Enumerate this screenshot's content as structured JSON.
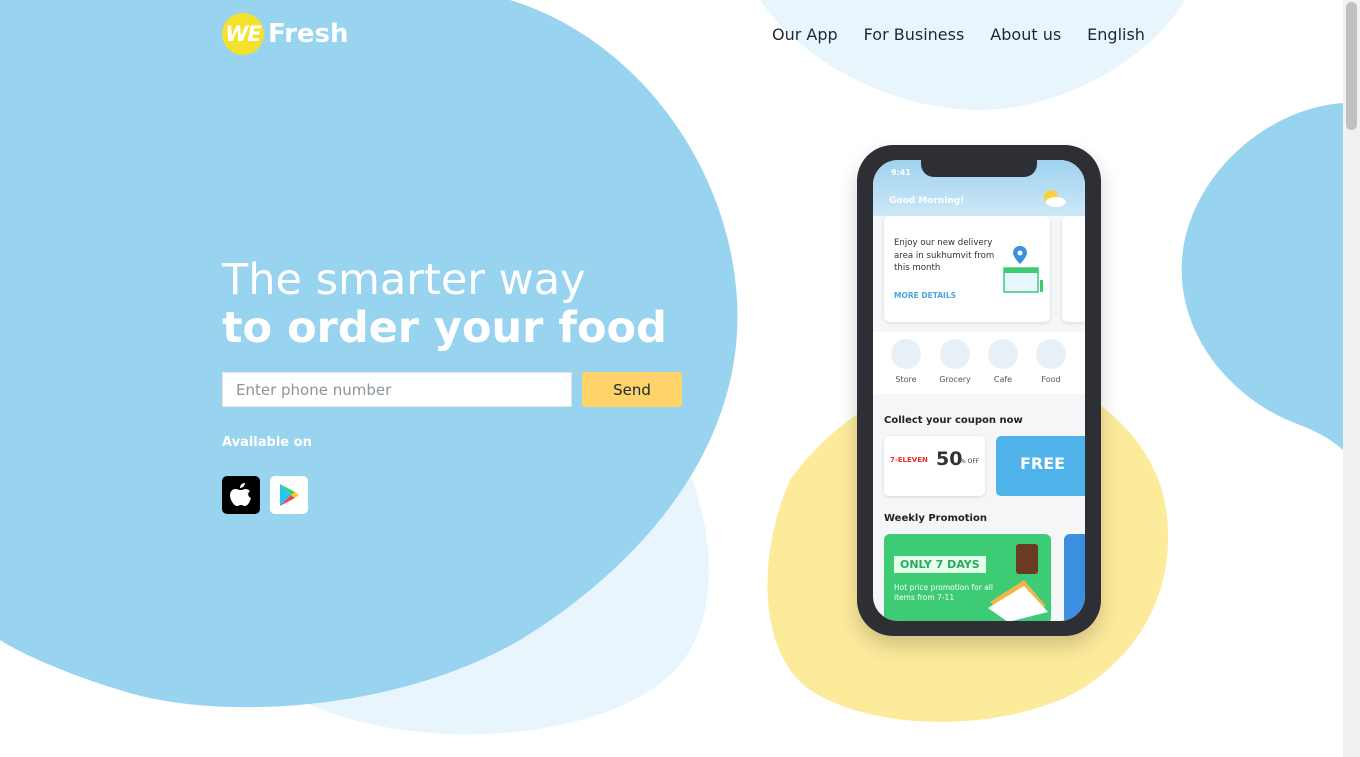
{
  "header": {
    "logo_mark": "WE",
    "logo_word": "Fresh",
    "nav": [
      "Our App",
      "For Business",
      "About us",
      "English"
    ]
  },
  "hero": {
    "line1": "The smarter way",
    "line2": "to order your food",
    "phone_placeholder": "Enter phone number",
    "send_label": "Send",
    "available_on": "Available on",
    "stores": [
      "apple-icon",
      "google-play-icon"
    ]
  },
  "app_screen": {
    "time": "9:41",
    "greeting": "Good Morning!",
    "card_text": "Enjoy our new delivery area in sukhumvit from this month",
    "card_link": "MORE DETAILS",
    "categories": [
      "Store",
      "Grocery",
      "Cafe",
      "Food"
    ],
    "coupon_title": "Collect your coupon now",
    "coupon_brand": "7-ELEVEN",
    "coupon_value": "50",
    "coupon_off": "% OFF",
    "coupon2_label": "FREE",
    "promo_title": "Weekly Promotion",
    "promo_badge": "ONLY 7 DAYS",
    "promo_desc": "Hot price promotion for all items from 7-11"
  },
  "colors": {
    "sky_blue": "#98d3ef",
    "pale_blue": "#e9f5fc",
    "yellow_blob": "#fdeb9c",
    "send_button": "#ffd36a",
    "logo_yellow": "#f5e12a",
    "nav_text": "#1c2a33"
  }
}
